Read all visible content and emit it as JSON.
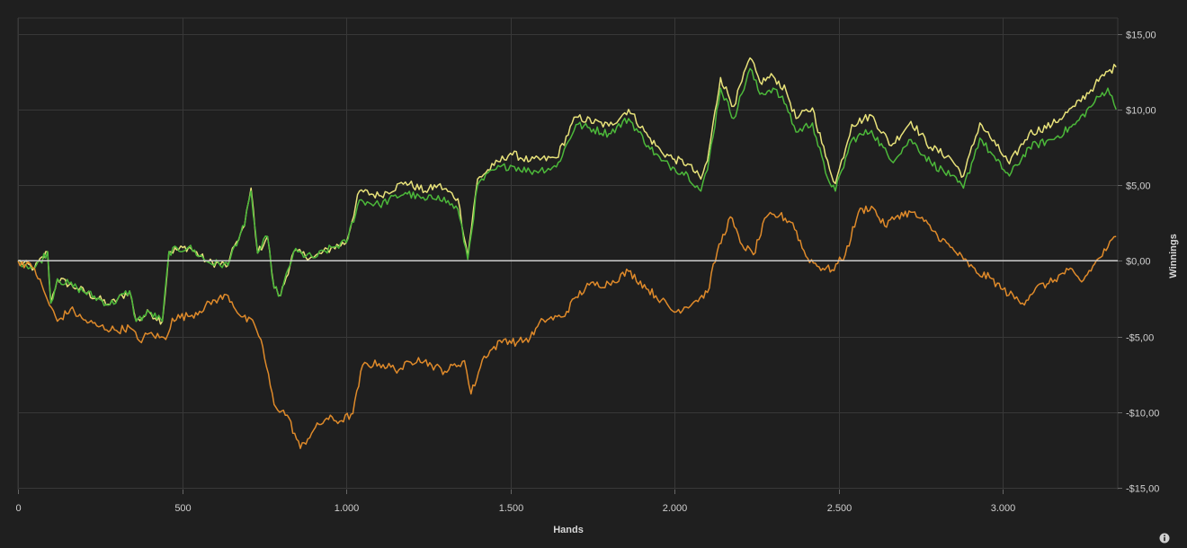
{
  "chart_data": {
    "type": "line",
    "xlabel": "Hands",
    "ylabel": "Winnings",
    "xlim": [
      0,
      3350
    ],
    "ylim": [
      -15,
      15
    ],
    "x_ticks": [
      0,
      500,
      1000,
      1500,
      2000,
      2500,
      3000
    ],
    "x_tick_labels": [
      "0",
      "500",
      "1.000",
      "1.500",
      "2.000",
      "2.500",
      "3.000"
    ],
    "y_ticks": [
      15,
      10,
      5,
      0,
      -5,
      -10,
      -15
    ],
    "y_tick_labels": [
      "$15,00",
      "$10,00",
      "$5,00",
      "$0,00",
      "-$5,00",
      "-$10,00",
      "-$15,00"
    ],
    "grid": true,
    "reference_line": 0,
    "series": [
      {
        "color": "#e8e27a",
        "points": [
          [
            0,
            0
          ],
          [
            50,
            -0.5
          ],
          [
            90,
            0.6
          ],
          [
            100,
            -2.8
          ],
          [
            120,
            -1.2
          ],
          [
            180,
            -1.8
          ],
          [
            280,
            -2.9
          ],
          [
            340,
            -2
          ],
          [
            360,
            -4
          ],
          [
            400,
            -3.4
          ],
          [
            440,
            -4
          ],
          [
            460,
            0.6
          ],
          [
            520,
            0.9
          ],
          [
            580,
            -0.1
          ],
          [
            640,
            -0.3
          ],
          [
            660,
            1
          ],
          [
            690,
            2.3
          ],
          [
            710,
            4.8
          ],
          [
            730,
            0.5
          ],
          [
            760,
            1.6
          ],
          [
            780,
            -1.8
          ],
          [
            800,
            -2.3
          ],
          [
            840,
            0.6
          ],
          [
            900,
            0.2
          ],
          [
            960,
            0.9
          ],
          [
            1000,
            1.2
          ],
          [
            1040,
            4.6
          ],
          [
            1100,
            4.3
          ],
          [
            1180,
            5.2
          ],
          [
            1240,
            4.6
          ],
          [
            1280,
            5
          ],
          [
            1340,
            4.1
          ],
          [
            1370,
            0.3
          ],
          [
            1400,
            5.4
          ],
          [
            1450,
            6.3
          ],
          [
            1500,
            7.1
          ],
          [
            1560,
            6.6
          ],
          [
            1640,
            6.8
          ],
          [
            1700,
            9.5
          ],
          [
            1800,
            8.9
          ],
          [
            1860,
            10
          ],
          [
            1920,
            8.2
          ],
          [
            1960,
            7.2
          ],
          [
            2000,
            6.7
          ],
          [
            2040,
            6.4
          ],
          [
            2080,
            5.4
          ],
          [
            2100,
            6.6
          ],
          [
            2140,
            12.1
          ],
          [
            2180,
            10.2
          ],
          [
            2230,
            13.4
          ],
          [
            2260,
            11.8
          ],
          [
            2300,
            12.2
          ],
          [
            2340,
            11.2
          ],
          [
            2370,
            9.4
          ],
          [
            2420,
            10.1
          ],
          [
            2460,
            6.9
          ],
          [
            2490,
            5.1
          ],
          [
            2540,
            9
          ],
          [
            2600,
            9.6
          ],
          [
            2660,
            7.6
          ],
          [
            2720,
            9.2
          ],
          [
            2780,
            7.5
          ],
          [
            2840,
            6.8
          ],
          [
            2880,
            5.6
          ],
          [
            2930,
            9.1
          ],
          [
            2980,
            7.6
          ],
          [
            3020,
            6.4
          ],
          [
            3080,
            8.4
          ],
          [
            3150,
            9
          ],
          [
            3220,
            10.2
          ],
          [
            3280,
            11.6
          ],
          [
            3320,
            12.5
          ],
          [
            3345,
            12.8
          ]
        ]
      },
      {
        "color": "#4cb83a",
        "points": [
          [
            0,
            0
          ],
          [
            50,
            -0.5
          ],
          [
            90,
            0.6
          ],
          [
            100,
            -2.8
          ],
          [
            120,
            -1.2
          ],
          [
            180,
            -1.8
          ],
          [
            280,
            -2.9
          ],
          [
            340,
            -2
          ],
          [
            360,
            -4
          ],
          [
            400,
            -3.4
          ],
          [
            440,
            -4
          ],
          [
            460,
            0.6
          ],
          [
            520,
            0.9
          ],
          [
            580,
            -0.1
          ],
          [
            640,
            -0.3
          ],
          [
            660,
            1
          ],
          [
            690,
            2.3
          ],
          [
            710,
            4.6
          ],
          [
            730,
            0.5
          ],
          [
            760,
            1.6
          ],
          [
            780,
            -1.8
          ],
          [
            800,
            -2.3
          ],
          [
            840,
            0.6
          ],
          [
            900,
            0.2
          ],
          [
            960,
            0.9
          ],
          [
            1000,
            1.2
          ],
          [
            1040,
            4
          ],
          [
            1100,
            3.7
          ],
          [
            1180,
            4.5
          ],
          [
            1240,
            4
          ],
          [
            1280,
            4.3
          ],
          [
            1340,
            3.4
          ],
          [
            1370,
            0.1
          ],
          [
            1400,
            5
          ],
          [
            1450,
            6
          ],
          [
            1500,
            6.3
          ],
          [
            1560,
            5.9
          ],
          [
            1640,
            6.2
          ],
          [
            1700,
            9
          ],
          [
            1800,
            8.4
          ],
          [
            1860,
            9.4
          ],
          [
            1920,
            7.6
          ],
          [
            1960,
            6.6
          ],
          [
            2000,
            6.1
          ],
          [
            2040,
            5.7
          ],
          [
            2080,
            4.6
          ],
          [
            2100,
            6
          ],
          [
            2140,
            11.4
          ],
          [
            2180,
            9.4
          ],
          [
            2230,
            12.7
          ],
          [
            2260,
            11
          ],
          [
            2300,
            11.4
          ],
          [
            2340,
            10.3
          ],
          [
            2370,
            8.5
          ],
          [
            2420,
            9.1
          ],
          [
            2460,
            5.8
          ],
          [
            2490,
            4.6
          ],
          [
            2540,
            8
          ],
          [
            2600,
            8.6
          ],
          [
            2660,
            6.6
          ],
          [
            2720,
            8
          ],
          [
            2780,
            6.5
          ],
          [
            2840,
            5.6
          ],
          [
            2880,
            4.8
          ],
          [
            2930,
            8.1
          ],
          [
            2980,
            6.6
          ],
          [
            3020,
            5.6
          ],
          [
            3080,
            7.5
          ],
          [
            3150,
            8
          ],
          [
            3220,
            9
          ],
          [
            3280,
            10.5
          ],
          [
            3320,
            11.4
          ],
          [
            3345,
            10
          ]
        ]
      },
      {
        "color": "#df8a2a",
        "points": [
          [
            0,
            0
          ],
          [
            50,
            -0.5
          ],
          [
            90,
            -2.6
          ],
          [
            120,
            -4
          ],
          [
            160,
            -3.2
          ],
          [
            200,
            -3.9
          ],
          [
            240,
            -4.3
          ],
          [
            300,
            -4.6
          ],
          [
            340,
            -4.4
          ],
          [
            370,
            -5.3
          ],
          [
            400,
            -4.8
          ],
          [
            450,
            -5.2
          ],
          [
            470,
            -3.8
          ],
          [
            530,
            -3.6
          ],
          [
            600,
            -2.6
          ],
          [
            640,
            -2.3
          ],
          [
            680,
            -3.7
          ],
          [
            720,
            -4.2
          ],
          [
            740,
            -5.2
          ],
          [
            780,
            -9.5
          ],
          [
            820,
            -10.2
          ],
          [
            860,
            -12.4
          ],
          [
            900,
            -11.2
          ],
          [
            940,
            -10.4
          ],
          [
            980,
            -10.6
          ],
          [
            1020,
            -10.1
          ],
          [
            1050,
            -6.9
          ],
          [
            1100,
            -6.8
          ],
          [
            1160,
            -7.2
          ],
          [
            1220,
            -6.4
          ],
          [
            1260,
            -6.9
          ],
          [
            1300,
            -7.3
          ],
          [
            1360,
            -6.6
          ],
          [
            1380,
            -8.8
          ],
          [
            1420,
            -6.3
          ],
          [
            1480,
            -5.2
          ],
          [
            1520,
            -5.4
          ],
          [
            1560,
            -5.1
          ],
          [
            1600,
            -3.9
          ],
          [
            1660,
            -3.7
          ],
          [
            1700,
            -2.4
          ],
          [
            1740,
            -1.6
          ],
          [
            1800,
            -1.5
          ],
          [
            1860,
            -0.7
          ],
          [
            1920,
            -1.9
          ],
          [
            1960,
            -2.6
          ],
          [
            2000,
            -3.4
          ],
          [
            2060,
            -2.7
          ],
          [
            2100,
            -2.1
          ],
          [
            2130,
            0.6
          ],
          [
            2170,
            2.9
          ],
          [
            2200,
            1.2
          ],
          [
            2240,
            0.4
          ],
          [
            2280,
            2.9
          ],
          [
            2320,
            3
          ],
          [
            2360,
            2.5
          ],
          [
            2400,
            0.3
          ],
          [
            2440,
            -0.4
          ],
          [
            2480,
            -0.6
          ],
          [
            2520,
            0.4
          ],
          [
            2560,
            3.2
          ],
          [
            2600,
            3.6
          ],
          [
            2640,
            2.3
          ],
          [
            2680,
            3
          ],
          [
            2720,
            3.2
          ],
          [
            2760,
            2.6
          ],
          [
            2800,
            1.7
          ],
          [
            2840,
            0.9
          ],
          [
            2880,
            0.1
          ],
          [
            2920,
            -0.8
          ],
          [
            2960,
            -1.1
          ],
          [
            3000,
            -1.9
          ],
          [
            3060,
            -2.8
          ],
          [
            3100,
            -1.8
          ],
          [
            3140,
            -1.5
          ],
          [
            3200,
            -0.6
          ],
          [
            3240,
            -1.4
          ],
          [
            3280,
            -0.2
          ],
          [
            3320,
            0.9
          ],
          [
            3345,
            1.6
          ]
        ]
      }
    ]
  },
  "ui": {
    "info_icon": "info-icon",
    "background_color": "#1f1f1f",
    "grid_color": "#383838",
    "zero_line_color": "#cccccc"
  }
}
